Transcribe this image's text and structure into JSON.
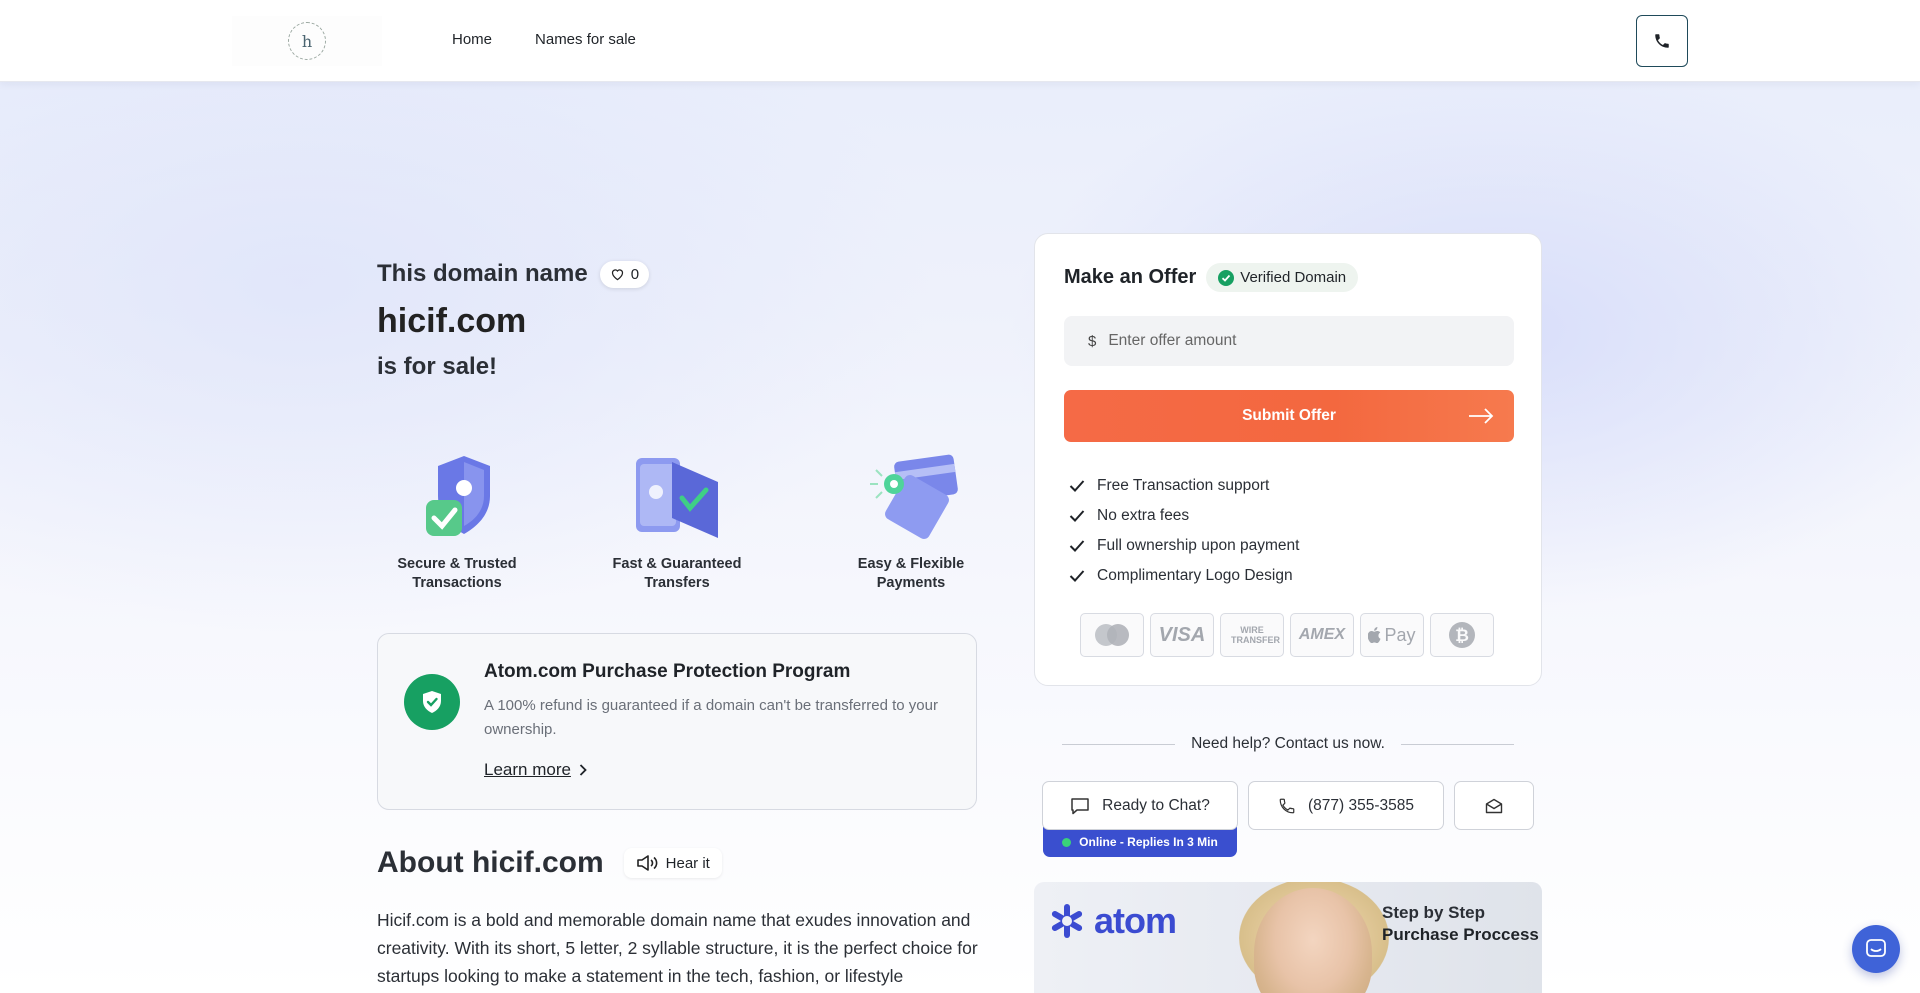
{
  "header": {
    "logo_letter": "h",
    "nav": [
      "Home",
      "Names for sale"
    ]
  },
  "hero": {
    "title_prefix": "This domain name",
    "likes": "0",
    "domain": "hicif.com",
    "suffix": "is for sale!"
  },
  "features": [
    {
      "label": "Secure & Trusted Transactions",
      "icon": "shield-check-icon"
    },
    {
      "label": "Fast & Guaranteed Transfers",
      "icon": "transfer-icon"
    },
    {
      "label": "Easy & Flexible Payments",
      "icon": "payment-cards-icon"
    }
  ],
  "protection": {
    "title": "Atom.com Purchase Protection Program",
    "text": "A 100% refund is guaranteed if a domain can't be transferred to your ownership.",
    "link": "Learn more"
  },
  "about": {
    "heading": "About hicif.com",
    "hear_label": "Hear it",
    "text": "Hicif.com is a bold and memorable domain name that exudes innovation and creativity. With its short, 5 letter, 2 syllable structure, it is the perfect choice for startups looking to make a statement in the tech, fashion, or lifestyle"
  },
  "offer": {
    "heading": "Make an Offer",
    "verified": "Verified Domain",
    "currency": "$",
    "placeholder": "Enter offer amount",
    "submit": "Submit Offer",
    "checks": [
      "Free Transaction support",
      "No extra fees",
      "Full ownership upon payment",
      "Complimentary Logo Design"
    ],
    "payments": [
      "mastercard",
      "VISA",
      "WIRE TRANSFER",
      "AMEX",
      "Pay",
      "bitcoin"
    ]
  },
  "help": {
    "text": "Need help? Contact us now.",
    "chat": "Ready to Chat?",
    "online": "Online - Replies In 3 Min",
    "phone": "(877) 355-3585"
  },
  "banner": {
    "brand": "atom",
    "line1": "Step by Step",
    "line2": "Purchase Proccess"
  },
  "colors": {
    "accent": "#f56a46",
    "brand_blue": "#3b4bd1",
    "success": "#17a062"
  }
}
